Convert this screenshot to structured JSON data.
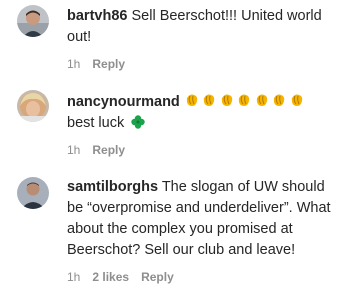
{
  "comments": [
    {
      "username": "bartvh86",
      "text": "Sell Beerschot!!! United world out!",
      "time": "1h",
      "likes": "",
      "reply_label": "Reply"
    },
    {
      "username": "nancynourmand",
      "text": "best luck",
      "emoji_row": "clapping-hands x7",
      "emoji_tail": "four-leaf-clover",
      "time": "1h",
      "likes": "",
      "reply_label": "Reply"
    },
    {
      "username": "samtilborghs",
      "text": "The slogan of UW should be “overpromise and underdeliver”. What about the complex you promised at Beerschot? Sell our club and leave!",
      "time": "1h",
      "likes": "2 likes",
      "reply_label": "Reply"
    }
  ],
  "colors": {
    "text": "#262626",
    "muted": "#8e8e8e",
    "clap": "#f5b400",
    "clover": "#1aa34a"
  }
}
